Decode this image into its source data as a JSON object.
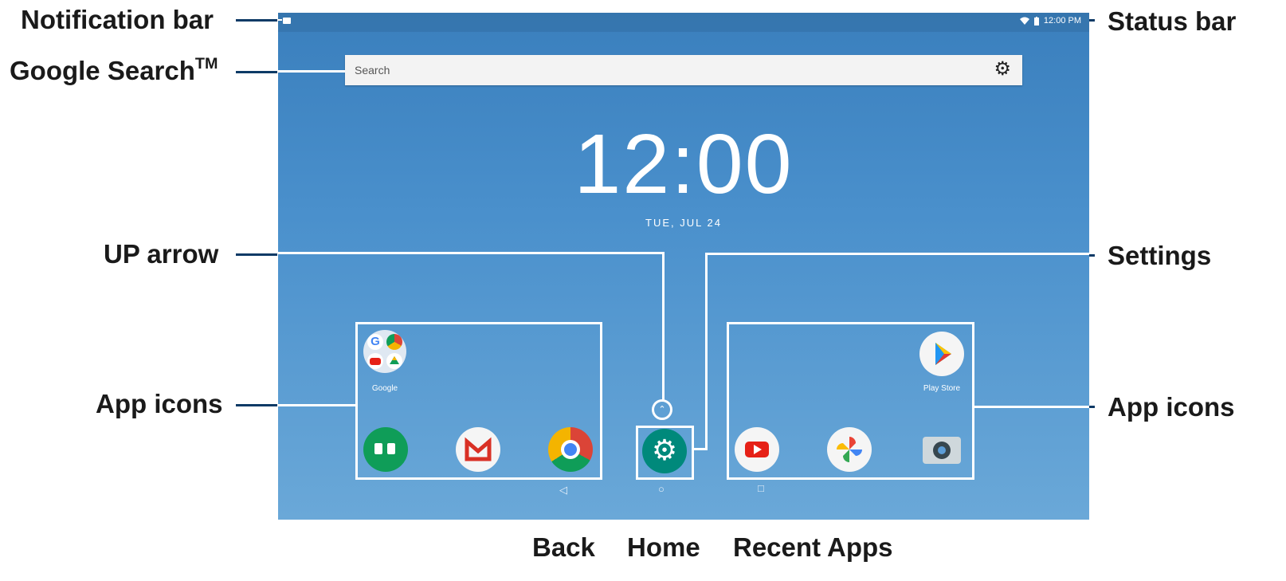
{
  "callouts": {
    "notification_bar": "Notification bar",
    "google_search": "Google Search",
    "google_search_mark": "TM",
    "up_arrow": "UP arrow",
    "app_icons_left": "App icons",
    "status_bar": "Status bar",
    "settings": "Settings",
    "app_icons_right": "App icons",
    "back": "Back",
    "home": "Home",
    "recent_apps": "Recent Apps"
  },
  "status_bar": {
    "time": "12:00 PM",
    "icons": [
      "wifi-icon",
      "battery-icon"
    ]
  },
  "notification_bar": {
    "icons": [
      "notification-icon"
    ]
  },
  "search": {
    "placeholder": "Search",
    "icon": "gear-icon"
  },
  "clock": {
    "time": "12:00",
    "date": "TUE, JUL 24"
  },
  "apps": {
    "google_folder_label": "Google",
    "play_store_label": "Play Store",
    "dock": [
      "hangouts-icon",
      "gmail-icon",
      "chrome-icon",
      "settings-icon",
      "youtube-icon",
      "photos-icon",
      "camera-icon"
    ]
  },
  "nav": {
    "back": "◁",
    "home": "○",
    "recent": "□"
  },
  "colors": {
    "callout_line": "#0d3a66",
    "screen_top": "#3a7fbd",
    "screen_bottom": "#6aa8d8"
  }
}
